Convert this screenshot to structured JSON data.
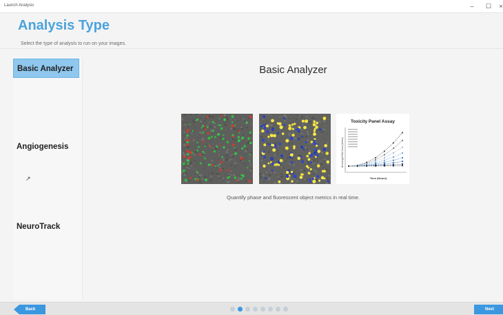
{
  "window": {
    "title": "Launch Analysis",
    "minimize_glyph": "–",
    "maximize_glyph": "☐",
    "close_glyph": "×"
  },
  "header": {
    "title": "Analysis Type",
    "subtitle": "Select the type of analysis to run on your images."
  },
  "sidebar": {
    "items": [
      {
        "label": "Basic Analyzer",
        "active": true
      },
      {
        "label": "Angiogenesis",
        "active": false
      },
      {
        "label": "NeuroTrack",
        "active": false
      }
    ]
  },
  "main": {
    "title": "Basic Analyzer",
    "description": "Quantify phase and fluorescent object metrics in real time.",
    "images": [
      {
        "icon": "phase-fluorescence-micrograph"
      },
      {
        "icon": "segmentation-mask-micrograph"
      },
      {
        "icon": "toxicity-chart-thumbnail",
        "chart_data": {
          "type": "line",
          "title": "Toxicity Panel Assay",
          "xlabel": "Time (Hours)",
          "ylabel": "NeuroLight Red Count (1/mm²)"
        }
      }
    ]
  },
  "footer": {
    "back_label": "Back",
    "next_label": "Next",
    "page_count": 8,
    "current_page": 2
  },
  "colors": {
    "accent": "#3b97e0",
    "title": "#4aa3dc",
    "active_item": "#8fc7ee"
  }
}
